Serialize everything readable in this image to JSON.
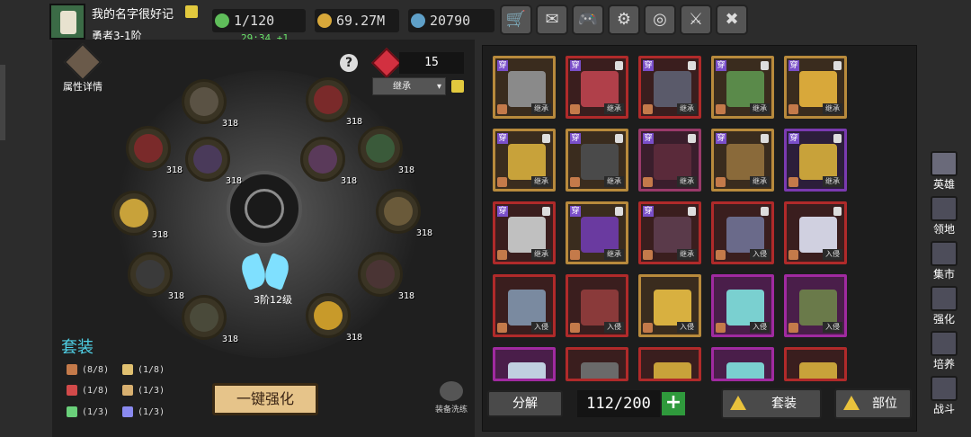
{
  "player": {
    "name": "我的名字很好记",
    "rank": "勇者3-1阶"
  },
  "stats": {
    "energy": "1/120",
    "energy_timer": "29:34 +1",
    "gold": "69.27M",
    "gems": "20790"
  },
  "top_buttons": [
    {
      "name": "shop-cart-icon",
      "glyph": "🛒"
    },
    {
      "name": "mail-icon",
      "glyph": "✉"
    },
    {
      "name": "gamepad-icon",
      "glyph": "🎮"
    },
    {
      "name": "gear-icon",
      "glyph": "⚙"
    },
    {
      "name": "color-wheel-icon",
      "glyph": "◎"
    },
    {
      "name": "claw-icon",
      "glyph": "⚔"
    },
    {
      "name": "crossed-swords-icon",
      "glyph": "✖"
    }
  ],
  "left": {
    "attr_label": "属性详情",
    "gem_count": "15",
    "filter_select": "继承",
    "core_label": "3阶12级",
    "set_title": "套装",
    "set_bonuses": [
      {
        "icon": "shield-icon",
        "text": "(8/8)",
        "color": "#c47a4a"
      },
      {
        "icon": "crown-icon",
        "text": "(1/8)",
        "color": "#e0c070"
      },
      {
        "icon": "no-entry-icon",
        "text": "(1/8)",
        "color": "#d24a4a"
      },
      {
        "icon": "leaf-icon",
        "text": "(1/3)",
        "color": "#d8b070"
      },
      {
        "icon": "eye-icon",
        "text": "(1/3)",
        "color": "#6ad07a"
      },
      {
        "icon": "bars-icon",
        "text": "(1/3)",
        "color": "#8a8af0"
      }
    ],
    "strengthen_all": "一键强化",
    "refine_label": "装备洗练",
    "slots": [
      {
        "level": "318",
        "color": "#5a5244"
      },
      {
        "level": "318",
        "color": "#7a2a2a"
      },
      {
        "level": "318",
        "color": "#7a2a2a"
      },
      {
        "level": "318",
        "color": "#4a3a5a"
      },
      {
        "level": "318",
        "color": "#5a3a5a"
      },
      {
        "level": "318",
        "color": "#3a5a3a"
      },
      {
        "level": "318",
        "color": "#c8a23a"
      },
      {
        "level": "318",
        "color": "#6a5a3a"
      },
      {
        "level": "318",
        "color": "#3a3a3a"
      },
      {
        "level": "318",
        "color": "#4a3434"
      },
      {
        "level": "318",
        "color": "#4a4a3a"
      },
      {
        "level": "318",
        "color": "#c89a2a"
      }
    ]
  },
  "inventory": {
    "items": [
      {
        "label": "继承",
        "border": "#b88a3c",
        "bg": "#3a2c1e",
        "art": "#8a8a8a",
        "tag": "穿",
        "lock": false
      },
      {
        "label": "继承",
        "border": "#b02a2a",
        "bg": "#3a1e1e",
        "art": "#b0404a",
        "tag": "穿",
        "lock": true
      },
      {
        "label": "继承",
        "border": "#b02a2a",
        "bg": "#3a1e1e",
        "art": "#5a5a6a",
        "tag": "穿",
        "lock": true
      },
      {
        "label": "继承",
        "border": "#b88a3c",
        "bg": "#3a2c1e",
        "art": "#5a8a4a",
        "tag": "穿",
        "lock": true
      },
      {
        "label": "继承",
        "border": "#b88a3c",
        "bg": "#3a2c1e",
        "art": "#d8a83a",
        "tag": "穿",
        "lock": true
      },
      {
        "label": "继承",
        "border": "#b88a3c",
        "bg": "#3a2c1e",
        "art": "#c8a23a",
        "tag": "穿",
        "lock": true
      },
      {
        "label": "继承",
        "border": "#b88a3c",
        "bg": "#3a2c1e",
        "art": "#4a4a4a",
        "tag": "穿",
        "lock": true
      },
      {
        "label": "继承",
        "border": "#9a3a6a",
        "bg": "#3a1e2c",
        "art": "#5a2a3a",
        "tag": "穿",
        "lock": true
      },
      {
        "label": "继承",
        "border": "#b88a3c",
        "bg": "#3a2c1e",
        "art": "#8a6a3a",
        "tag": "穿",
        "lock": true
      },
      {
        "label": "继承",
        "border": "#7a3ab0",
        "bg": "#2c1e3a",
        "art": "#c8a23a",
        "tag": "穿",
        "lock": true
      },
      {
        "label": "继承",
        "border": "#b02a2a",
        "bg": "#3a1e1e",
        "art": "#c0c0c0",
        "tag": "穿",
        "lock": true
      },
      {
        "label": "继承",
        "border": "#b88a3c",
        "bg": "#3a2c1e",
        "art": "#6a3aa0",
        "tag": "穿",
        "lock": true
      },
      {
        "label": "继承",
        "border": "#b02a2a",
        "bg": "#3a1e1e",
        "art": "#5a3a4a",
        "tag": "穿",
        "lock": true
      },
      {
        "label": "入侵",
        "border": "#b02a2a",
        "bg": "#3a1e1e",
        "art": "#6a6a8a",
        "tag": "",
        "lock": true
      },
      {
        "label": "入侵",
        "border": "#b02a2a",
        "bg": "#3a1e1e",
        "art": "#d0d0e0",
        "tag": "",
        "lock": true
      },
      {
        "label": "入侵",
        "border": "#b02a2a",
        "bg": "#3a1e1e",
        "art": "#7a8aa0",
        "tag": "",
        "lock": false
      },
      {
        "label": "入侵",
        "border": "#b02a2a",
        "bg": "#3a1e1e",
        "art": "#8a3a3a",
        "tag": "",
        "lock": false
      },
      {
        "label": "入侵",
        "border": "#b88a3c",
        "bg": "#3a2c1e",
        "art": "#d8b040",
        "tag": "",
        "lock": false
      },
      {
        "label": "入侵",
        "border": "#a02aa0",
        "bg": "#4a1e4a",
        "art": "#7ad0d0",
        "tag": "",
        "lock": false
      },
      {
        "label": "入侵",
        "border": "#a02aa0",
        "bg": "#4a1e4a",
        "art": "#6a7a4a",
        "tag": "",
        "lock": false
      },
      {
        "label": "",
        "border": "#a02aa0",
        "bg": "#4a1e4a",
        "art": "#c0d0e0",
        "tag": "",
        "lock": false
      },
      {
        "label": "",
        "border": "#b02a2a",
        "bg": "#3a1e1e",
        "art": "#6a6a6a",
        "tag": "",
        "lock": false
      },
      {
        "label": "",
        "border": "#b02a2a",
        "bg": "#3a1e1e",
        "art": "#c8a23a",
        "tag": "",
        "lock": false
      },
      {
        "label": "",
        "border": "#a02aa0",
        "bg": "#4a1e4a",
        "art": "#7ad0d0",
        "tag": "",
        "lock": false
      },
      {
        "label": "",
        "border": "#b02a2a",
        "bg": "#3a1e1e",
        "art": "#c8a23a",
        "tag": "",
        "lock": false
      }
    ],
    "decompose": "分解",
    "capacity": "112/200",
    "sort_set": "套装",
    "sort_slot": "部位"
  },
  "sidebar": [
    {
      "label": "英雄",
      "name": "sidebar-item-hero",
      "active": true
    },
    {
      "label": "领地",
      "name": "sidebar-item-territory",
      "active": false
    },
    {
      "label": "集市",
      "name": "sidebar-item-market",
      "active": false
    },
    {
      "label": "强化",
      "name": "sidebar-item-strengthen",
      "active": false
    },
    {
      "label": "培养",
      "name": "sidebar-item-cultivate",
      "active": false
    },
    {
      "label": "战斗",
      "name": "sidebar-item-battle",
      "active": false
    }
  ]
}
